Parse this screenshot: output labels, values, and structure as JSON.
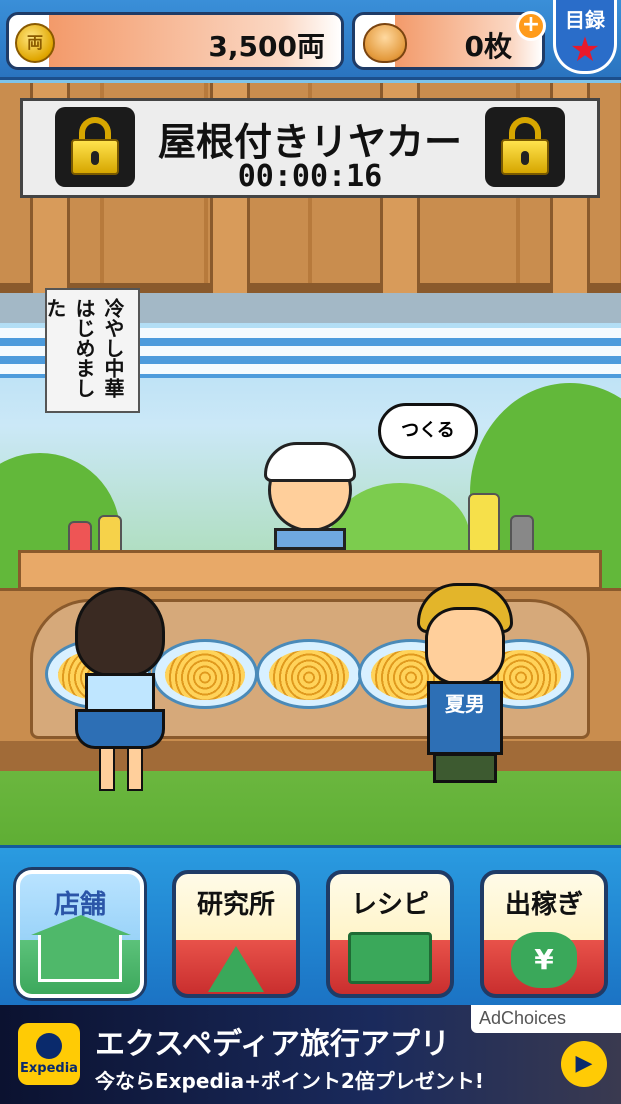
{
  "hud": {
    "money": "3,500両",
    "coin_glyph": "両",
    "tickets": "0枚",
    "plus": "+",
    "catalog_label": "目録",
    "catalog_star": "★"
  },
  "sign": {
    "title": "屋根付きリヤカー",
    "timer": "00:00:16"
  },
  "banner": "冷やし中華はじめました",
  "speech": "つくる",
  "boy_shirt": "夏男",
  "menu": {
    "items": [
      {
        "label": "店舗",
        "active": true
      },
      {
        "label": "研究所",
        "active": false
      },
      {
        "label": "レシピ",
        "active": false
      },
      {
        "label": "出稼ぎ",
        "active": false
      }
    ],
    "yen": "¥"
  },
  "ad": {
    "brand": "Expedia",
    "headline": "エクスペディア旅行アプリ",
    "subline": "今ならExpedia+ポイント2倍プレゼント!",
    "adchoices": "AdChoices",
    "play": "▶"
  },
  "colors": {
    "hud_blue": "#2a74c0",
    "accent_red": "#e8192b",
    "active_green": "#3da85c"
  }
}
